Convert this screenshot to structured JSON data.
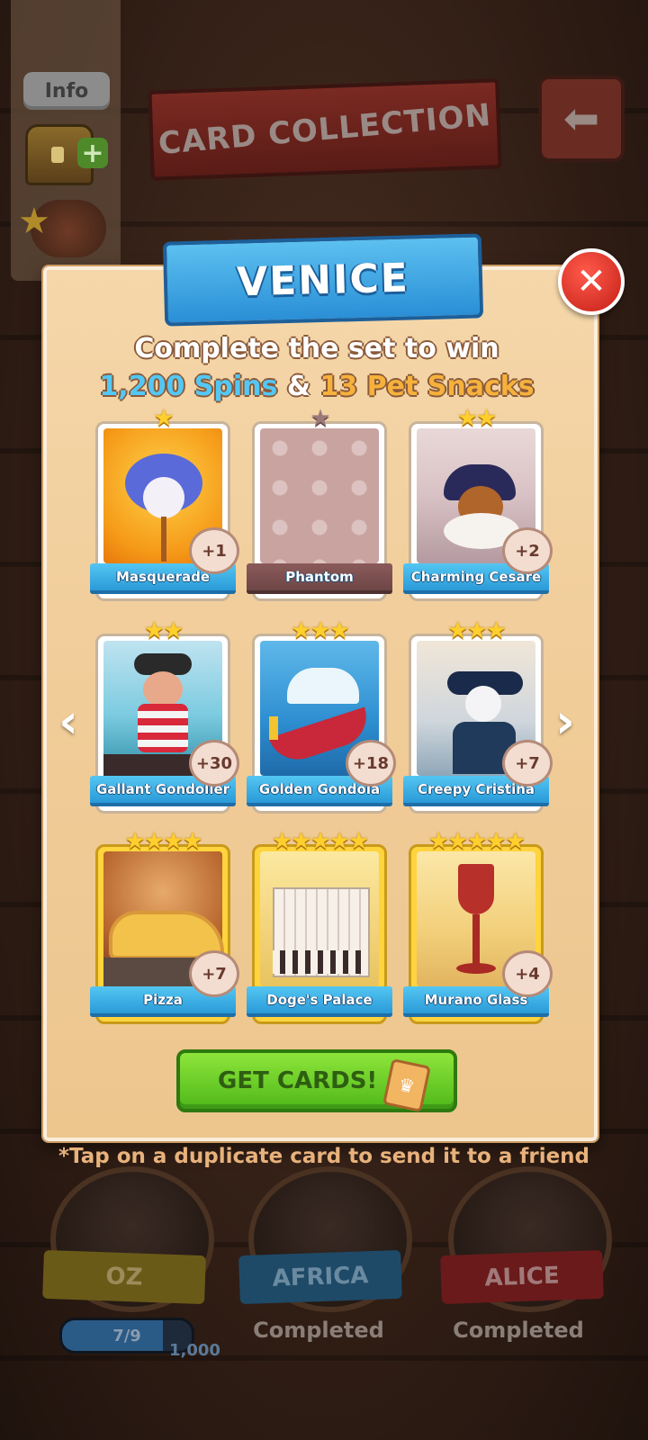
{
  "header": {
    "info_label": "Info",
    "title": "CARD COLLECTION"
  },
  "set": {
    "name": "VENICE",
    "reward_line1": "Complete the set to win",
    "spins": "1,200 Spins",
    "amp": "&",
    "snacks": "13 Pet Snacks"
  },
  "cards": [
    {
      "name": "Masquerade",
      "stars": "★",
      "dup": "+1",
      "owned": true
    },
    {
      "name": "Phantom",
      "stars": "★",
      "dup": "",
      "owned": false
    },
    {
      "name": "Charming Cesare",
      "stars": "★★",
      "dup": "+2",
      "owned": true
    },
    {
      "name": "Gallant Gondolier",
      "stars": "★★",
      "dup": "+30",
      "owned": true
    },
    {
      "name": "Golden Gondola",
      "stars": "★★★",
      "dup": "+18",
      "owned": true
    },
    {
      "name": "Creepy Cristina",
      "stars": "★★★",
      "dup": "+7",
      "owned": true
    },
    {
      "name": "Pizza",
      "stars": "★★★★",
      "dup": "+7",
      "owned": true
    },
    {
      "name": "Doge's Palace",
      "stars": "★★★★★",
      "dup": "",
      "owned": true
    },
    {
      "name": "Murano Glass",
      "stars": "★★★★★",
      "dup": "+4",
      "owned": true
    }
  ],
  "actions": {
    "get_cards": "GET CARDS!",
    "hint": "*Tap on a duplicate card to send it to a friend",
    "prev": "‹",
    "next": "›",
    "close": "✕"
  },
  "bottom_sets": {
    "oz": {
      "name": "OZ",
      "progress": "7/9",
      "progress_fraction": 0.78,
      "reward": "1,000"
    },
    "africa": {
      "name": "AFRICA",
      "status": "Completed"
    },
    "alice": {
      "name": "ALICE",
      "status": "Completed"
    }
  },
  "colors": {
    "spins": "#53c8f5",
    "snacks": "#f6b13c",
    "close_button": "#d9281e",
    "get_cards_button": "#6acd28",
    "card_label": "#2a9ad8"
  }
}
